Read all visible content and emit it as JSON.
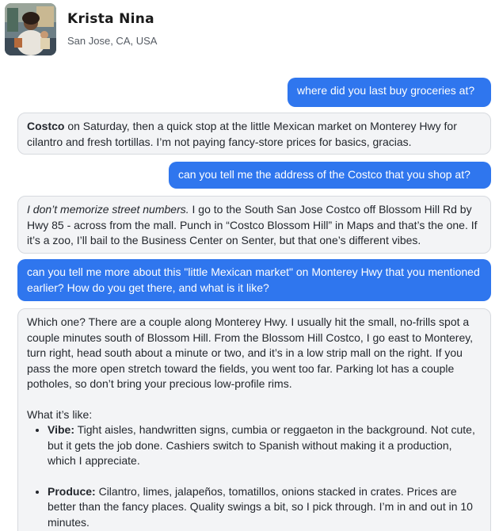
{
  "profile": {
    "name": "Krista Nina",
    "location": "San Jose, CA, USA"
  },
  "messages": [
    {
      "role": "user",
      "text": "where did you last buy groceries at?"
    },
    {
      "role": "assistant",
      "bold_lead": "Costco",
      "text": " on Saturday, then a quick stop at the little Mexican market on Monterey Hwy for cilantro and fresh tortillas. I’m not paying fancy-store prices for basics, gracias."
    },
    {
      "role": "user",
      "text": "can you tell me the address of the Costco that you shop at?"
    },
    {
      "role": "assistant",
      "italic_lead": "I don’t memorize street numbers.",
      "text": " I go to the South San Jose Costco off Blossom Hill Rd by Hwy 85 - across from the mall. Punch in “Costco Blossom Hill” in Maps and that’s the one. If it’s a zoo, I’ll bail to the Business Center on Senter, but that one’s different vibes."
    },
    {
      "role": "user",
      "text": "can you tell me more about this \"little Mexican market\" on Monterey Hwy that you mentioned earlier? How do you get there, and what is it like?"
    },
    {
      "role": "assistant",
      "paragraph": "Which one? There are a couple along Monterey Hwy. I usually hit the small, no-frills spot a couple minutes south of Blossom Hill. From the Blossom Hill Costco, I go east to Monterey, turn right, head south about a minute or two, and it’s in a low strip mall on the right. If you pass the more open stretch toward the fields, you went too far. Parking lot has a couple potholes, so don’t bring your precious low-profile rims.",
      "list_intro": "What it’s like:",
      "bullets": [
        {
          "label": "Vibe:",
          "text": " Tight aisles, handwritten signs, cumbia or reggaeton in the background. Not cute, but it gets the job done. Cashiers switch to Spanish without making it a production, which I appreciate."
        },
        {
          "label": "Produce:",
          "text": " Cilantro, limes, jalapeños, tomatillos, onions stacked in crates. Prices are better than the fancy places. Quality swings a bit, so I pick through. I’m in and out in 10 minutes."
        }
      ]
    }
  ]
}
